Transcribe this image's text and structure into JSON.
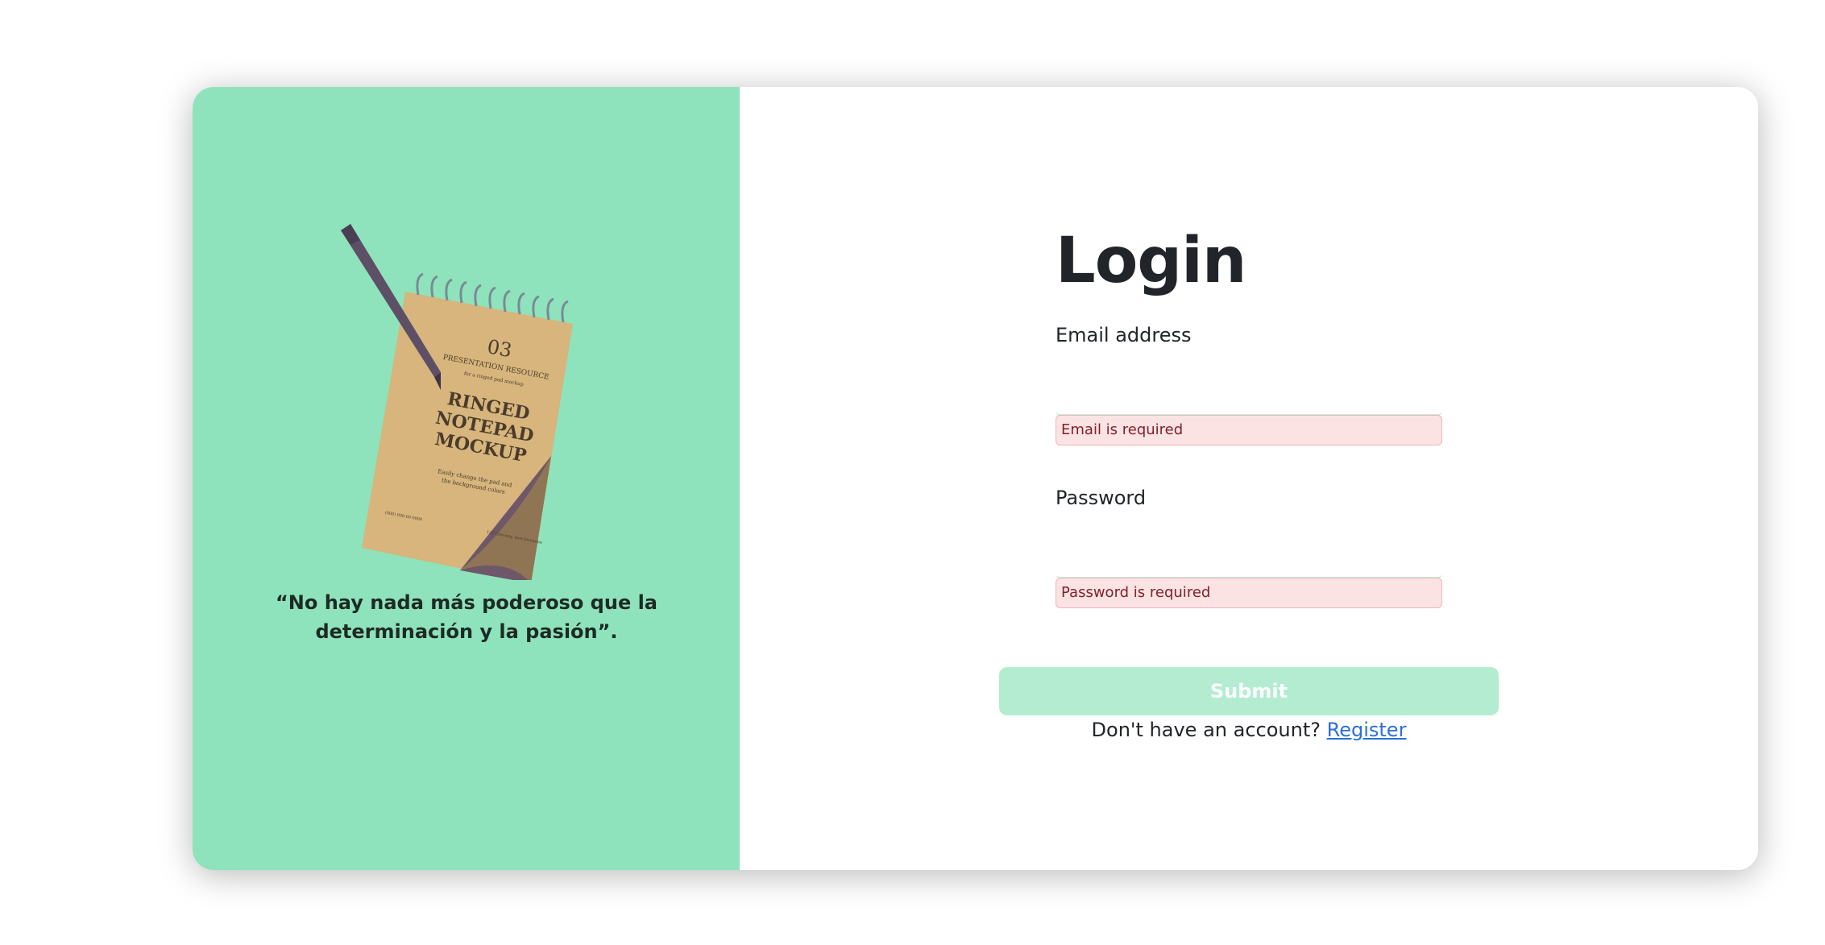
{
  "left_panel": {
    "background_color": "#8ee3bc",
    "illustration": {
      "kind": "notepad-with-pen",
      "number": "03",
      "small_heading": "PRESENTATION RESOURCE",
      "tagline": "for a ringed pad mockup",
      "main_title_lines": [
        "RINGED",
        "NOTEPAD",
        "MOCKUP"
      ],
      "caption_lines": [
        "Easily change the pad and",
        "the background colors"
      ],
      "footer_left": "(000) 000-00 0000",
      "footer_right": "123 Gleeway, new Jeremine"
    },
    "quote": "“No hay nada más poderoso que la determinación y la pasión”."
  },
  "login_form": {
    "title": "Login",
    "email": {
      "label": "Email address",
      "value": "",
      "placeholder": "",
      "error": "Email is required"
    },
    "password": {
      "label": "Password",
      "value": "",
      "placeholder": "",
      "error": "Password is required"
    },
    "submit_label": "Submit",
    "register_prompt": "Don't have an account?",
    "register_link": "Register"
  },
  "colors": {
    "accent": "#8ee3bc",
    "submit_disabled": "#b3ecd1",
    "error_bg": "#fbe3e4",
    "error_text": "#842029",
    "link": "#2a6fdc"
  }
}
